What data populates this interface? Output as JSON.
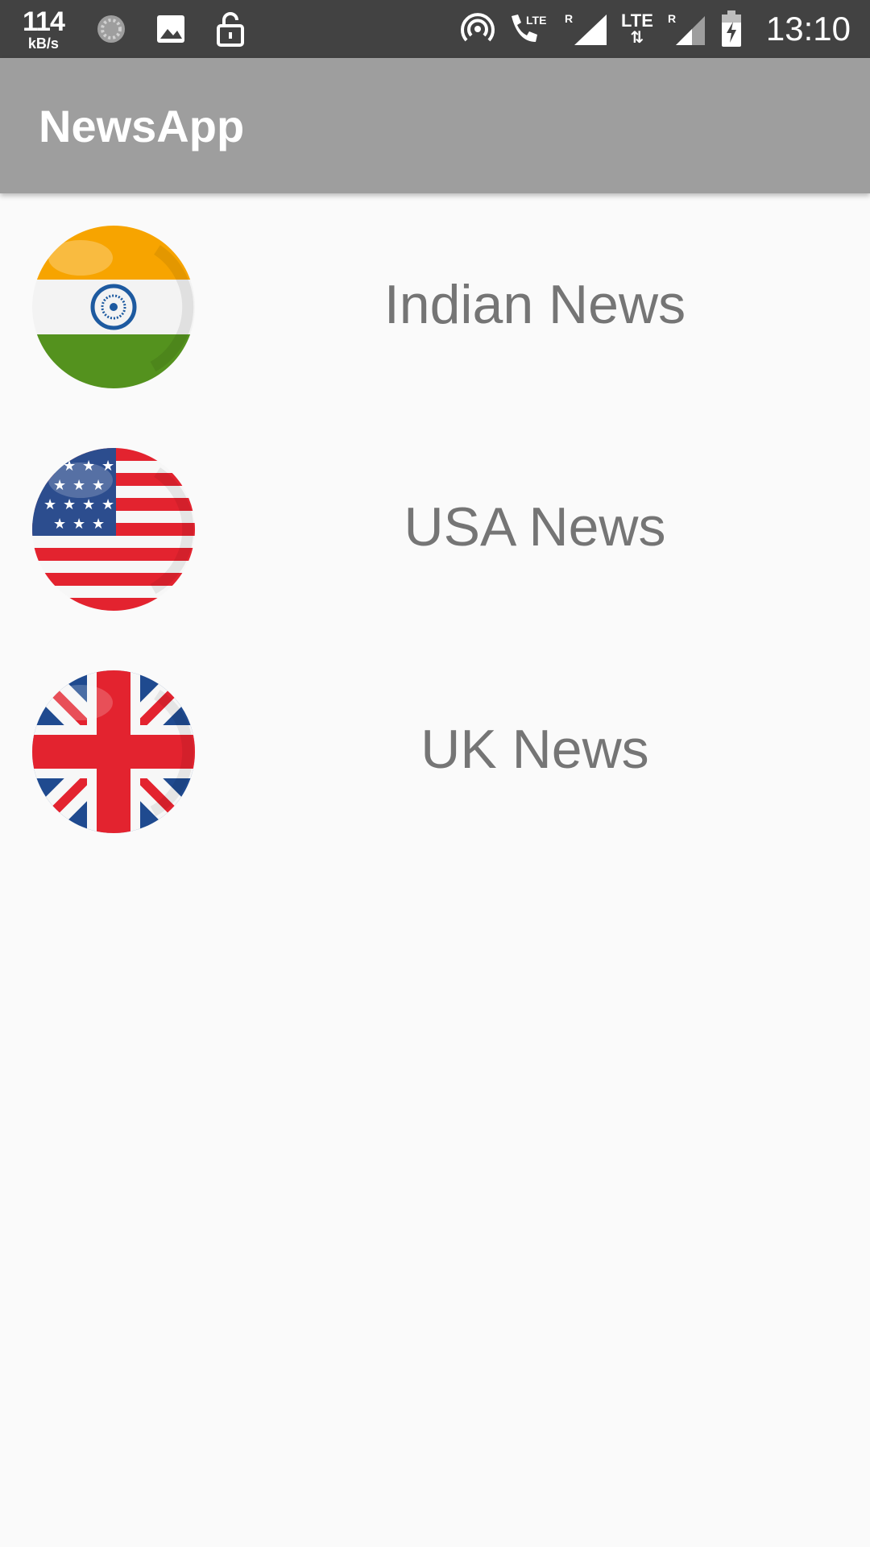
{
  "status_bar": {
    "speed_value": "114",
    "speed_unit": "kB/s",
    "network_label_1": "LTE",
    "roaming_1": "R",
    "network_label_2": "LTE",
    "roaming_2": "R",
    "time": "13:10",
    "icons": [
      "loading-icon",
      "image-icon",
      "unlock-icon",
      "hotspot-icon",
      "volte-call-icon",
      "signal-icon",
      "signal-icon",
      "battery-charging-icon"
    ]
  },
  "app_bar": {
    "title": "NewsApp",
    "color": "#9e9e9e"
  },
  "news_list": [
    {
      "label": "Indian News",
      "icon": "india-flag-icon"
    },
    {
      "label": "USA News",
      "icon": "usa-flag-icon"
    },
    {
      "label": "UK News",
      "icon": "uk-flag-icon"
    }
  ]
}
